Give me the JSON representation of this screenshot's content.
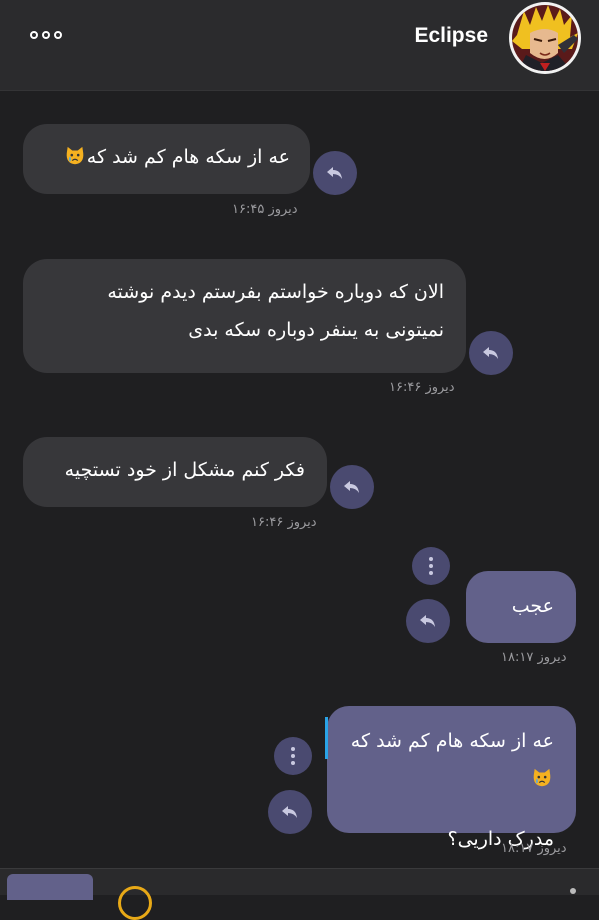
{
  "header": {
    "title": "Eclipse",
    "menu_icon": "more-horizontal-icon",
    "avatar_alt": "anime-character-avatar"
  },
  "messages": [
    {
      "side": "incoming",
      "text": "عه از سکه هام کم شد که",
      "emoji": "crying-cat-face",
      "time": "دیروز ۱۶:۴۵"
    },
    {
      "side": "incoming",
      "lines": [
        "الان که دوباره خواستم بفرستم دیدم نوشته",
        "نمیتونی به یىنفر دوباره سکه بدی"
      ],
      "time": "دیروز ۱۶:۴۶"
    },
    {
      "side": "incoming",
      "text": "فکر کنم مشکل از خود تستچیه",
      "time": "دیروز ۱۶:۴۶"
    },
    {
      "side": "outgoing",
      "text": "عجب",
      "time": "دیروز ۱۸:۱۷"
    },
    {
      "side": "outgoing",
      "quote": "عه از سکه هام کم شد که",
      "emoji": "crying-cat-face",
      "text": "مدرک داریی؟",
      "time": "دیروز ۱۸:۱۷"
    }
  ],
  "icons": {
    "reply": "reply-arrow-icon",
    "options": "vertical-dots-icon",
    "bottom_emoji": "emoji-icon"
  },
  "colors": {
    "background": "#1f1f21",
    "header": "#2b2b2d",
    "incoming_bubble": "#37373a",
    "outgoing_bubble": "#62618a",
    "action_button": "#4a4a70",
    "quote_bar": "#2aa3e6",
    "timestamp": "#9a9a9e"
  }
}
